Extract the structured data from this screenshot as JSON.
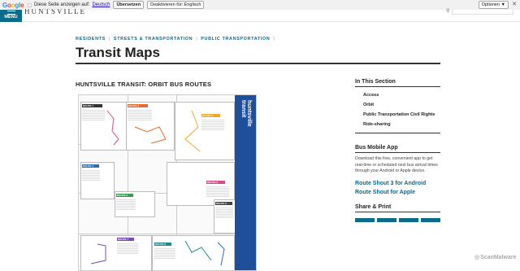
{
  "translate_bar": {
    "logo": [
      "G",
      "o",
      "o",
      "g",
      "l",
      "e"
    ],
    "message": "Diese Seite anzeigen auf:",
    "language": "Deutsch",
    "translate_button": "Übersetzen",
    "disable_button": "Deaktivieren für: Englisch",
    "options_button": "Optionen ▼",
    "close": "✕"
  },
  "header": {
    "menu_label": "MENU",
    "logo_text": "HUNTSVILLE",
    "search_placeholder": ""
  },
  "breadcrumb": [
    "RESIDENTS",
    "STREETS & TRANSPORTATION",
    "PUBLIC TRANSPORTATION"
  ],
  "breadcrumb_sep": "|",
  "page_title": "Transit Maps",
  "section_title": "HUNTSVILLE TRANSIT: ORBIT BUS ROUTES",
  "map": {
    "side_title_1": "huntsville",
    "side_title_2": "transit",
    "route_labels": [
      "ROUTE 1",
      "ROUTE 2",
      "ROUTE 3",
      "ROUTE 4",
      "ROUTE 5",
      "ROUTE 6",
      "ROUTE 7",
      "ROUTE 8",
      "ROUTE 9"
    ],
    "route_colors": [
      "#333333",
      "#e86a2c",
      "#f2a825",
      "#2a6db5",
      "#3b9e4f",
      "#d64b8d",
      "#7a4bb0",
      "#1e8a8a",
      "#444444"
    ]
  },
  "sidebar": {
    "in_this_section": "In This Section",
    "links": [
      "Access",
      "Orbit",
      "Public Transportation Civil Rights",
      "Ride-sharing"
    ],
    "bus_app_title": "Bus Mobile App",
    "bus_app_text": "Download this free, convenient app to get real-time or scheduled next bus arrival times through your Android or Apple device.",
    "android_link": "Route Shout 3 for Android",
    "apple_link": "Route Shout for Apple",
    "share_title": "Share & Print"
  },
  "watermark": "ScanMalware"
}
